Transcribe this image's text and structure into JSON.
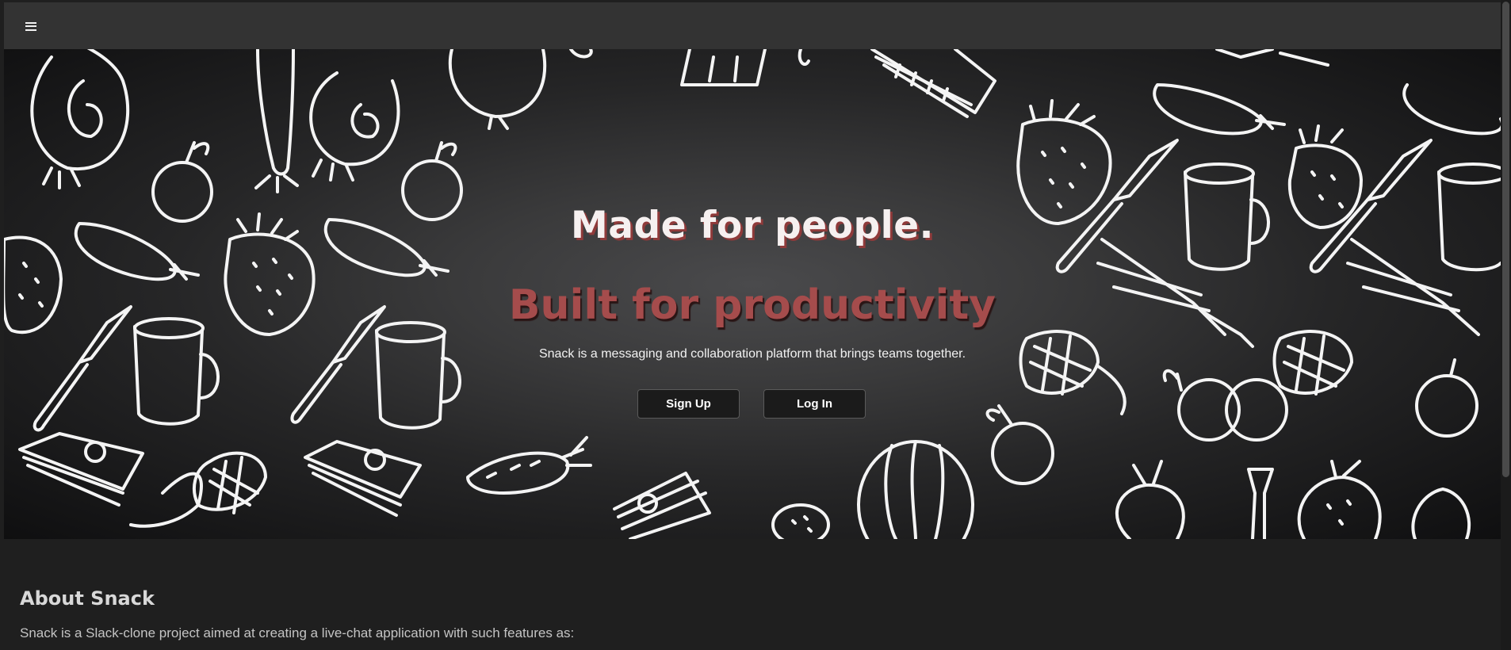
{
  "navbar": {
    "menu_icon": "hamburger-menu-icon"
  },
  "hero": {
    "title": "Made for people.",
    "subtitle": "Built for productivity",
    "description": "Snack is a messaging and collaboration platform that brings teams together.",
    "signup_label": "Sign Up",
    "login_label": "Log In",
    "background": "chalkboard food doodles",
    "colors": {
      "title": "#f6f0f0",
      "title_shadow": "#8f3a3a",
      "subtitle": "#a54c4c",
      "button_bg": "#1b1b1b"
    }
  },
  "about": {
    "heading": "About Snack",
    "text": "Snack is a Slack-clone project aimed at creating a live-chat application with such features as:"
  }
}
